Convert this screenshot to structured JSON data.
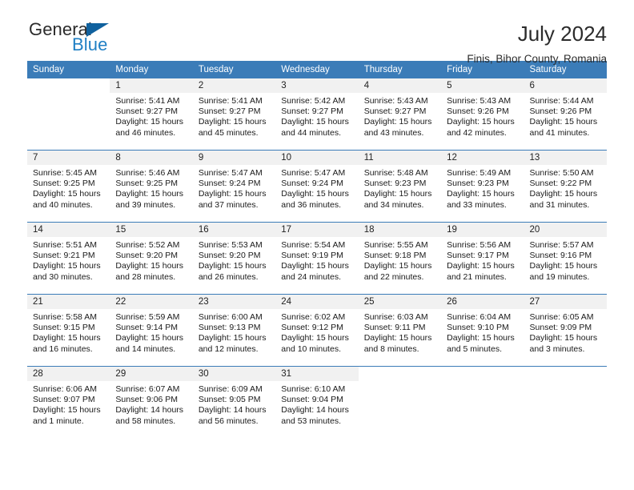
{
  "brand": {
    "name_dark": "General",
    "name_blue": "Blue",
    "accent_blue": "#1f7fc4",
    "triangle_blue": "#10619e"
  },
  "header": {
    "title": "July 2024",
    "subtitle": "Finis, Bihor County, Romania",
    "header_bg": "#3b7cb8",
    "daynum_bg": "#f1f1f1"
  },
  "weekdays": [
    "Sunday",
    "Monday",
    "Tuesday",
    "Wednesday",
    "Thursday",
    "Friday",
    "Saturday"
  ],
  "weeks": [
    [
      {
        "day": "",
        "sunrise": "",
        "sunset": "",
        "daylight_1": "",
        "daylight_2": "",
        "blank": true
      },
      {
        "day": "1",
        "sunrise": "Sunrise: 5:41 AM",
        "sunset": "Sunset: 9:27 PM",
        "daylight_1": "Daylight: 15 hours",
        "daylight_2": "and 46 minutes."
      },
      {
        "day": "2",
        "sunrise": "Sunrise: 5:41 AM",
        "sunset": "Sunset: 9:27 PM",
        "daylight_1": "Daylight: 15 hours",
        "daylight_2": "and 45 minutes."
      },
      {
        "day": "3",
        "sunrise": "Sunrise: 5:42 AM",
        "sunset": "Sunset: 9:27 PM",
        "daylight_1": "Daylight: 15 hours",
        "daylight_2": "and 44 minutes."
      },
      {
        "day": "4",
        "sunrise": "Sunrise: 5:43 AM",
        "sunset": "Sunset: 9:27 PM",
        "daylight_1": "Daylight: 15 hours",
        "daylight_2": "and 43 minutes."
      },
      {
        "day": "5",
        "sunrise": "Sunrise: 5:43 AM",
        "sunset": "Sunset: 9:26 PM",
        "daylight_1": "Daylight: 15 hours",
        "daylight_2": "and 42 minutes."
      },
      {
        "day": "6",
        "sunrise": "Sunrise: 5:44 AM",
        "sunset": "Sunset: 9:26 PM",
        "daylight_1": "Daylight: 15 hours",
        "daylight_2": "and 41 minutes."
      }
    ],
    [
      {
        "day": "7",
        "sunrise": "Sunrise: 5:45 AM",
        "sunset": "Sunset: 9:25 PM",
        "daylight_1": "Daylight: 15 hours",
        "daylight_2": "and 40 minutes."
      },
      {
        "day": "8",
        "sunrise": "Sunrise: 5:46 AM",
        "sunset": "Sunset: 9:25 PM",
        "daylight_1": "Daylight: 15 hours",
        "daylight_2": "and 39 minutes."
      },
      {
        "day": "9",
        "sunrise": "Sunrise: 5:47 AM",
        "sunset": "Sunset: 9:24 PM",
        "daylight_1": "Daylight: 15 hours",
        "daylight_2": "and 37 minutes."
      },
      {
        "day": "10",
        "sunrise": "Sunrise: 5:47 AM",
        "sunset": "Sunset: 9:24 PM",
        "daylight_1": "Daylight: 15 hours",
        "daylight_2": "and 36 minutes."
      },
      {
        "day": "11",
        "sunrise": "Sunrise: 5:48 AM",
        "sunset": "Sunset: 9:23 PM",
        "daylight_1": "Daylight: 15 hours",
        "daylight_2": "and 34 minutes."
      },
      {
        "day": "12",
        "sunrise": "Sunrise: 5:49 AM",
        "sunset": "Sunset: 9:23 PM",
        "daylight_1": "Daylight: 15 hours",
        "daylight_2": "and 33 minutes."
      },
      {
        "day": "13",
        "sunrise": "Sunrise: 5:50 AM",
        "sunset": "Sunset: 9:22 PM",
        "daylight_1": "Daylight: 15 hours",
        "daylight_2": "and 31 minutes."
      }
    ],
    [
      {
        "day": "14",
        "sunrise": "Sunrise: 5:51 AM",
        "sunset": "Sunset: 9:21 PM",
        "daylight_1": "Daylight: 15 hours",
        "daylight_2": "and 30 minutes."
      },
      {
        "day": "15",
        "sunrise": "Sunrise: 5:52 AM",
        "sunset": "Sunset: 9:20 PM",
        "daylight_1": "Daylight: 15 hours",
        "daylight_2": "and 28 minutes."
      },
      {
        "day": "16",
        "sunrise": "Sunrise: 5:53 AM",
        "sunset": "Sunset: 9:20 PM",
        "daylight_1": "Daylight: 15 hours",
        "daylight_2": "and 26 minutes."
      },
      {
        "day": "17",
        "sunrise": "Sunrise: 5:54 AM",
        "sunset": "Sunset: 9:19 PM",
        "daylight_1": "Daylight: 15 hours",
        "daylight_2": "and 24 minutes."
      },
      {
        "day": "18",
        "sunrise": "Sunrise: 5:55 AM",
        "sunset": "Sunset: 9:18 PM",
        "daylight_1": "Daylight: 15 hours",
        "daylight_2": "and 22 minutes."
      },
      {
        "day": "19",
        "sunrise": "Sunrise: 5:56 AM",
        "sunset": "Sunset: 9:17 PM",
        "daylight_1": "Daylight: 15 hours",
        "daylight_2": "and 21 minutes."
      },
      {
        "day": "20",
        "sunrise": "Sunrise: 5:57 AM",
        "sunset": "Sunset: 9:16 PM",
        "daylight_1": "Daylight: 15 hours",
        "daylight_2": "and 19 minutes."
      }
    ],
    [
      {
        "day": "21",
        "sunrise": "Sunrise: 5:58 AM",
        "sunset": "Sunset: 9:15 PM",
        "daylight_1": "Daylight: 15 hours",
        "daylight_2": "and 16 minutes."
      },
      {
        "day": "22",
        "sunrise": "Sunrise: 5:59 AM",
        "sunset": "Sunset: 9:14 PM",
        "daylight_1": "Daylight: 15 hours",
        "daylight_2": "and 14 minutes."
      },
      {
        "day": "23",
        "sunrise": "Sunrise: 6:00 AM",
        "sunset": "Sunset: 9:13 PM",
        "daylight_1": "Daylight: 15 hours",
        "daylight_2": "and 12 minutes."
      },
      {
        "day": "24",
        "sunrise": "Sunrise: 6:02 AM",
        "sunset": "Sunset: 9:12 PM",
        "daylight_1": "Daylight: 15 hours",
        "daylight_2": "and 10 minutes."
      },
      {
        "day": "25",
        "sunrise": "Sunrise: 6:03 AM",
        "sunset": "Sunset: 9:11 PM",
        "daylight_1": "Daylight: 15 hours",
        "daylight_2": "and 8 minutes."
      },
      {
        "day": "26",
        "sunrise": "Sunrise: 6:04 AM",
        "sunset": "Sunset: 9:10 PM",
        "daylight_1": "Daylight: 15 hours",
        "daylight_2": "and 5 minutes."
      },
      {
        "day": "27",
        "sunrise": "Sunrise: 6:05 AM",
        "sunset": "Sunset: 9:09 PM",
        "daylight_1": "Daylight: 15 hours",
        "daylight_2": "and 3 minutes."
      }
    ],
    [
      {
        "day": "28",
        "sunrise": "Sunrise: 6:06 AM",
        "sunset": "Sunset: 9:07 PM",
        "daylight_1": "Daylight: 15 hours",
        "daylight_2": "and 1 minute."
      },
      {
        "day": "29",
        "sunrise": "Sunrise: 6:07 AM",
        "sunset": "Sunset: 9:06 PM",
        "daylight_1": "Daylight: 14 hours",
        "daylight_2": "and 58 minutes."
      },
      {
        "day": "30",
        "sunrise": "Sunrise: 6:09 AM",
        "sunset": "Sunset: 9:05 PM",
        "daylight_1": "Daylight: 14 hours",
        "daylight_2": "and 56 minutes."
      },
      {
        "day": "31",
        "sunrise": "Sunrise: 6:10 AM",
        "sunset": "Sunset: 9:04 PM",
        "daylight_1": "Daylight: 14 hours",
        "daylight_2": "and 53 minutes."
      },
      {
        "day": "",
        "sunrise": "",
        "sunset": "",
        "daylight_1": "",
        "daylight_2": "",
        "blank": true
      },
      {
        "day": "",
        "sunrise": "",
        "sunset": "",
        "daylight_1": "",
        "daylight_2": "",
        "blank": true
      },
      {
        "day": "",
        "sunrise": "",
        "sunset": "",
        "daylight_1": "",
        "daylight_2": "",
        "blank": true
      }
    ]
  ]
}
